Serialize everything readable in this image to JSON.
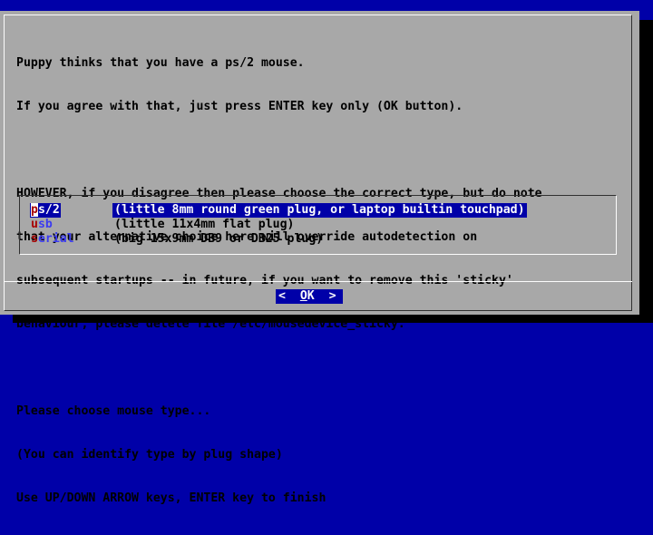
{
  "dialog": {
    "lines": [
      "Puppy thinks that you have a ps/2 mouse.",
      "If you agree with that, just press ENTER key only (OK button).",
      "",
      "HOWEVER, if you disagree then please choose the correct type, but do note",
      "that your alternative choice here will override autodetection on",
      "subsequent startups -- in future, if you want to remove this 'sticky'",
      "behaviour, please delete file /etc/mousedevice_sticky.",
      "",
      "Please choose mouse type...",
      "(You can identify type by plug shape)",
      "Use UP/DOWN ARROW keys, ENTER key to finish"
    ]
  },
  "menu": {
    "items": [
      {
        "hot": "p",
        "rest": "s/2",
        "description": "(little 8mm round green plug, or laptop builtin touchpad)",
        "selected": true
      },
      {
        "hot": "u",
        "rest": "sb",
        "description": "(little 11x4mm flat plug)",
        "selected": false
      },
      {
        "hot": "s",
        "rest": "erial",
        "description": "(big 15x9mm DB9 or DB25 plug)",
        "selected": false
      }
    ]
  },
  "buttons": {
    "ok_left": "<  ",
    "ok_hot": "O",
    "ok_rest": "K  >"
  },
  "colors": {
    "background": "#0000a8",
    "dialog": "#a8a8a8",
    "highlight": "#0000a8",
    "hotkey": "#a80000",
    "item_text": "#3c3cf0"
  }
}
